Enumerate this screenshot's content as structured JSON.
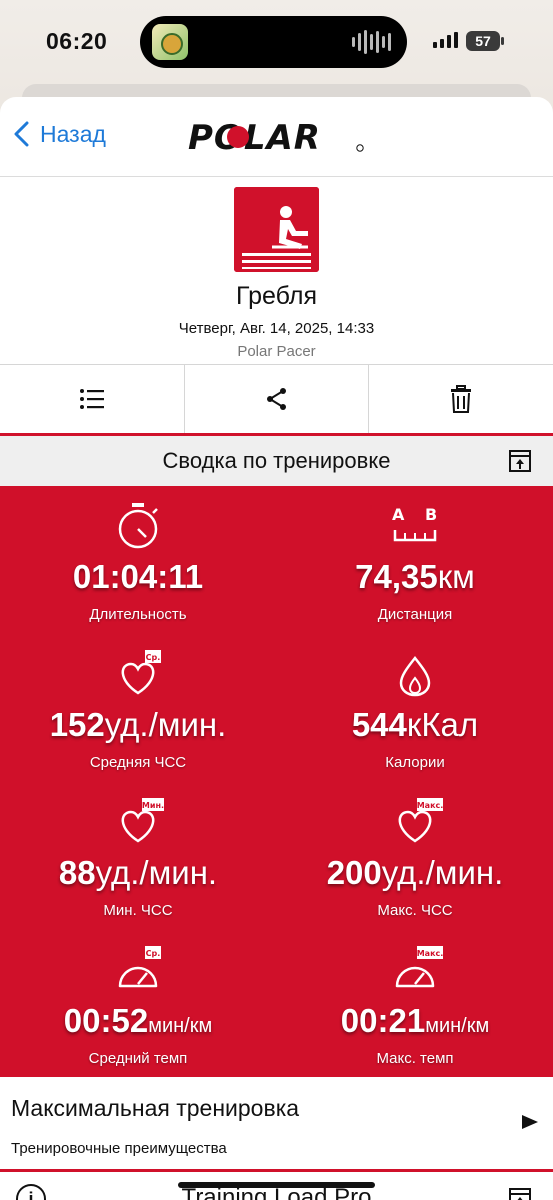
{
  "status_bar": {
    "time": "06:20",
    "battery": "57"
  },
  "nav": {
    "back_label": "Назад",
    "brand": "POLAR"
  },
  "session": {
    "sport": "Гребля",
    "date": "Четверг, Авг. 14, 2025, 14:33",
    "device": "Polar Pacer"
  },
  "toolbar": {
    "items": [
      "list-icon",
      "share-icon",
      "trash-icon"
    ]
  },
  "summary": {
    "title": "Сводка по тренировке",
    "stats": [
      {
        "icon": "stopwatch-icon",
        "value": "01:04:11",
        "unit": "",
        "label": "Длительность"
      },
      {
        "icon": "distance-icon",
        "icon_text": [
          "A",
          "B"
        ],
        "value": "74,35",
        "unit": "км",
        "label": "Дистанция"
      },
      {
        "icon": "heart-icon",
        "badge": "Ср.",
        "value": "152",
        "unit": "уд./мин.",
        "label": "Средняя ЧСС"
      },
      {
        "icon": "flame-icon",
        "value": "544",
        "unit": "кКал",
        "label": "Калории"
      },
      {
        "icon": "heart-icon",
        "badge": "Мин.",
        "value": "88",
        "unit": "уд./мин.",
        "label": "Мин. ЧСС"
      },
      {
        "icon": "heart-icon",
        "badge": "Макс.",
        "value": "200",
        "unit": "уд./мин.",
        "label": "Макс. ЧСС"
      },
      {
        "icon": "gauge-icon",
        "badge": "Ср.",
        "value": "00:52",
        "unit": "мин/км",
        "label": "Средний темп"
      },
      {
        "icon": "gauge-icon",
        "badge": "Макс.",
        "value": "00:21",
        "unit": "мин/км",
        "label": "Макс. темп"
      }
    ]
  },
  "benefit": {
    "title": "Максимальная тренировка",
    "subtitle": "Тренировочные преимущества"
  },
  "training_load": {
    "title": "Training Load Pro",
    "info": "i"
  },
  "colors": {
    "accent": "#d0102a",
    "link": "#1e7ad8"
  }
}
